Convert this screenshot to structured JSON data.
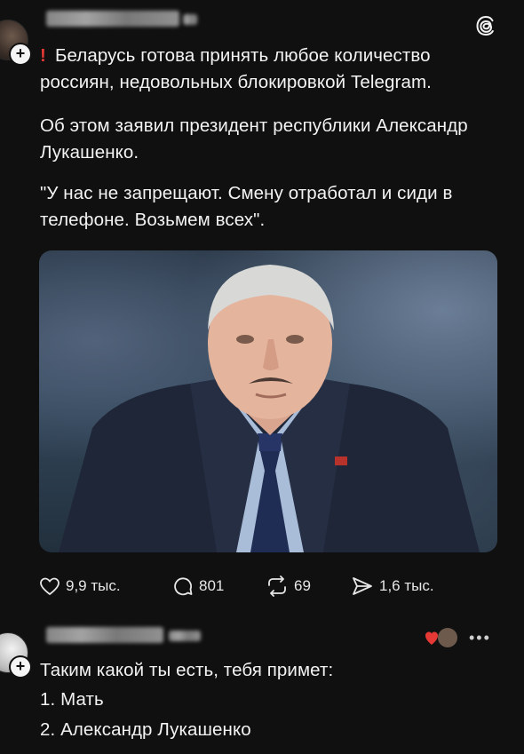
{
  "post": {
    "author_name": "",
    "headline_mark": "!",
    "headline": "Беларусь готова принять любое количество россиян, недовольных блокировкой Telegram.",
    "paragraph1": "Об этом заявил президент республики Александр Лукашенко.",
    "paragraph2": "\"У нас не запрещают. Смену отработал и сиди в телефоне. Возьмем всех\".",
    "image_icon": "portrait-photo"
  },
  "actions": {
    "likes": "9,9 тыс.",
    "comments": "801",
    "reposts": "69",
    "shares": "1,6 тыс."
  },
  "reply": {
    "author_name": "",
    "line1": "Таким какой ты есть, тебя примет:",
    "line2": "1. Мать",
    "line3": "2. Александр Лукашенко"
  },
  "colors": {
    "background": "#101010",
    "text": "#f3f3f3",
    "accent_red": "#e53935"
  }
}
